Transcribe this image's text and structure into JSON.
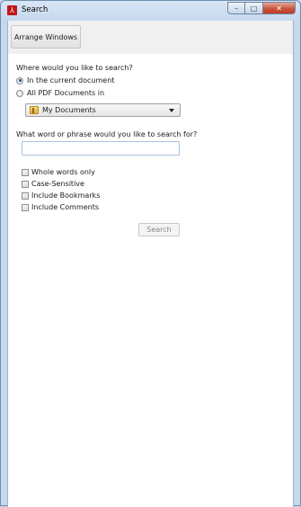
{
  "window": {
    "title": "Search",
    "app_icon": "adobe-acrobat-icon",
    "controls": {
      "minimize": "minimize-icon",
      "maximize": "maximize-icon",
      "close": "close-icon"
    }
  },
  "toolbar": {
    "arrange_label": "Arrange Windows"
  },
  "search_scope": {
    "question": "Where would you like to search?",
    "options": [
      {
        "label": "In the current document",
        "checked": true
      },
      {
        "label": "All PDF Documents in",
        "checked": false
      }
    ],
    "location": {
      "selected": "My Documents",
      "icon": "folder-icon"
    }
  },
  "query": {
    "question": "What word or phrase would you like to search for?",
    "value": "",
    "placeholder": ""
  },
  "options": [
    {
      "label": "Whole words only",
      "checked": false
    },
    {
      "label": "Case-Sensitive",
      "checked": false
    },
    {
      "label": "Include Bookmarks",
      "checked": false
    },
    {
      "label": "Include Comments",
      "checked": false
    }
  ],
  "actions": {
    "search_label": "Search"
  }
}
